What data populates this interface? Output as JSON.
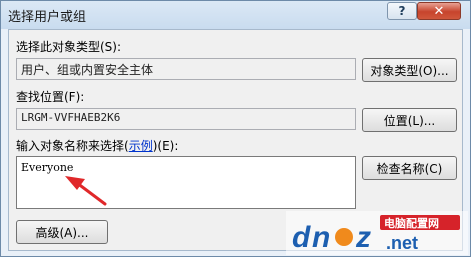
{
  "window": {
    "title": "选择用户或组",
    "help_label": "?",
    "close_label": "✕"
  },
  "object_type": {
    "label": "选择此对象类型(S):",
    "value": "用户、组或内置安全主体",
    "button_label": "对象类型(O)..."
  },
  "location": {
    "label": "查找位置(F):",
    "value": "LRGM-VVFHAEB2K6",
    "button_label": "位置(L)..."
  },
  "object_names": {
    "label_prefix": "输入对象名称来选择(",
    "label_link": "示例",
    "label_suffix": ")(E):",
    "value": "Everyone",
    "check_button_label": "检查名称(C)"
  },
  "advanced_button_label": "高级(A)...",
  "watermark": {
    "brand": "电脑配置网",
    "logo": "dnpz",
    "domain": ".net",
    "colors": {
      "blue": "#1d5fb0",
      "orange": "#f08a1c",
      "red": "#d6232a"
    }
  },
  "annotation": {
    "arrow_color": "#e0282a"
  }
}
